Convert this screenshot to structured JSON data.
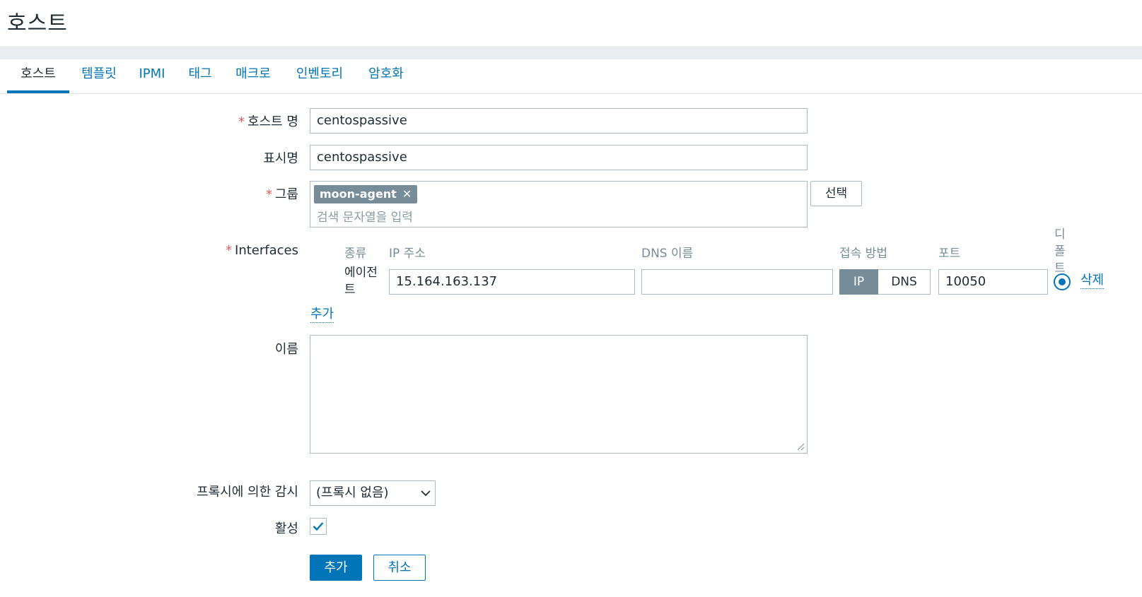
{
  "page": {
    "title": "호스트"
  },
  "tabs": [
    {
      "label": "호스트",
      "active": true
    },
    {
      "label": "템플릿"
    },
    {
      "label": "IPMI"
    },
    {
      "label": "태그"
    },
    {
      "label": "매크로"
    },
    {
      "label": "인벤토리"
    },
    {
      "label": "암호화"
    }
  ],
  "form": {
    "required_mark": "*",
    "host_name": {
      "label": "호스트 명",
      "value": "centospassive"
    },
    "visible_name": {
      "label": "표시명",
      "value": "centospassive"
    },
    "groups": {
      "label": "그룹",
      "tag": "moon-agent",
      "tag_remove": "✕",
      "placeholder": "검색 문자열을 입력",
      "select_button": "선택"
    },
    "interfaces": {
      "label": "Interfaces",
      "columns": {
        "type": "종류",
        "ip": "IP 주소",
        "dns": "DNS 이름",
        "connect": "접속 방법",
        "port": "포트",
        "default_line1": "디",
        "default_line2": "폴",
        "default_line3": "트"
      },
      "row": {
        "type_line1": "에이전",
        "type_line2": "트",
        "ip": "15.164.163.137",
        "dns": "",
        "connect_options": [
          "IP",
          "DNS"
        ],
        "connect_selected": "IP",
        "port": "10050",
        "remove_link": "삭제"
      },
      "add_link": "추가"
    },
    "description": {
      "label": "이름",
      "value": ""
    },
    "proxy": {
      "label": "프록시에 의한 감시",
      "selected": "(프록시 없음)"
    },
    "enabled": {
      "label": "활성",
      "checked": true
    },
    "buttons": {
      "add": "추가",
      "cancel": "취소"
    }
  },
  "colors": {
    "accent": "#0275b8",
    "tag_bg": "#768d99",
    "required": "#e45959",
    "border": "#acbbc2"
  }
}
